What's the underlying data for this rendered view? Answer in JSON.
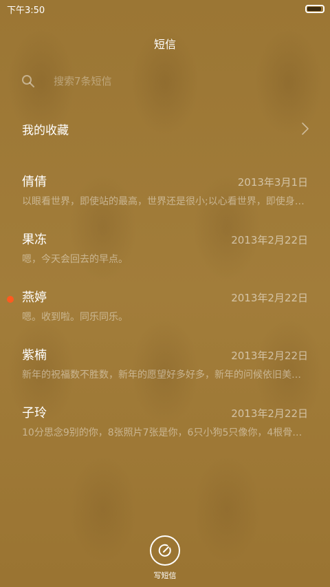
{
  "status_bar": {
    "time": "下午3:50",
    "battery_level": 0.9
  },
  "header": {
    "title": "短信"
  },
  "search": {
    "placeholder": "搜索7条短信"
  },
  "favorites": {
    "label": "我的收藏"
  },
  "threads": [
    {
      "name": "倩倩",
      "date": "2013年3月1日",
      "preview": "以眼看世界，即使站的最高，世界还是很小;以心看世界，即使身…",
      "unread": false
    },
    {
      "name": "果冻",
      "date": "2013年2月22日",
      "preview": "嗯，今天会回去的早点。",
      "unread": false
    },
    {
      "name": "燕婷",
      "date": "2013年2月22日",
      "preview": "嗯。收到啦。同乐同乐。",
      "unread": true
    },
    {
      "name": "紫楠",
      "date": "2013年2月22日",
      "preview": "新年的祝福数不胜数，新年的愿望好多好多，新年的问候依旧美…",
      "unread": false
    },
    {
      "name": "子玲",
      "date": "2013年2月22日",
      "preview": "10分思念9别的你，8张照片7张是你，6只小狗5只像你，4根骨…",
      "unread": false
    }
  ],
  "compose": {
    "label": "写短信",
    "icon": "compose-icon"
  },
  "colors": {
    "background": "#a07b38",
    "unread": "#ff5a1f"
  }
}
